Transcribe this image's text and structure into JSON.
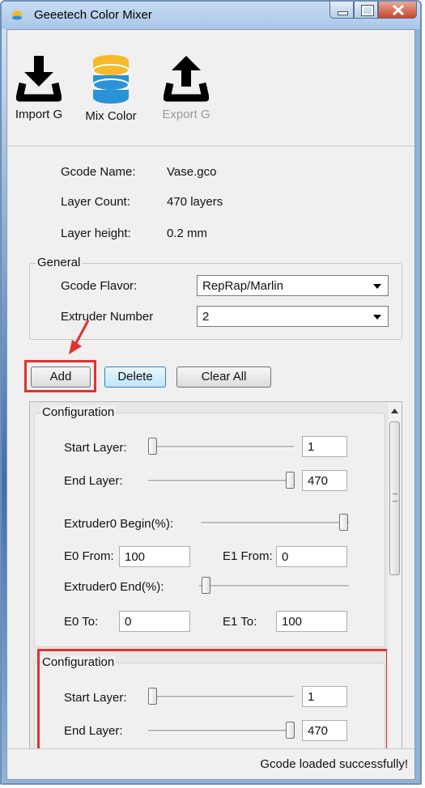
{
  "window": {
    "title": "Geeetech Color Mixer"
  },
  "toolbar": {
    "import_label": "Import G",
    "mix_label": "Mix Color",
    "export_label": "Export G"
  },
  "info": {
    "gcode_name_label": "Gcode Name:",
    "gcode_name_value": "Vase.gco",
    "layer_count_label": "Layer Count:",
    "layer_count_value": "470 layers",
    "layer_height_label": "Layer height:",
    "layer_height_value": "0.2 mm"
  },
  "general": {
    "title": "General",
    "flavor_label": "Gcode Flavor:",
    "flavor_value": "RepRap/Marlin",
    "extruder_label": "Extruder Number",
    "extruder_value": "2"
  },
  "actions": {
    "add": "Add",
    "delete": "Delete",
    "clear_all": "Clear All"
  },
  "configs": [
    {
      "title": "Configuration",
      "start_label": "Start Layer:",
      "start_value": "1",
      "end_label": "End Layer:",
      "end_value": "470",
      "begin_label": "Extruder0 Begin(%):",
      "e0_from_label": "E0 From:",
      "e0_from_value": "100",
      "e1_from_label": "E1 From:",
      "e1_from_value": "0",
      "end_pct_label": "Extruder0 End(%):",
      "e0_to_label": "E0 To:",
      "e0_to_value": "0",
      "e1_to_label": "E1 To:",
      "e1_to_value": "100"
    },
    {
      "title": "Configuration",
      "start_label": "Start Layer:",
      "start_value": "1",
      "end_label": "End Layer:",
      "end_value": "470"
    }
  ],
  "status": {
    "text": "Gcode loaded successfully!"
  },
  "colors": {
    "highlight": "#e03232",
    "mix_icon_yellow": "#f6b928",
    "mix_icon_blue": "#2a93d5"
  }
}
